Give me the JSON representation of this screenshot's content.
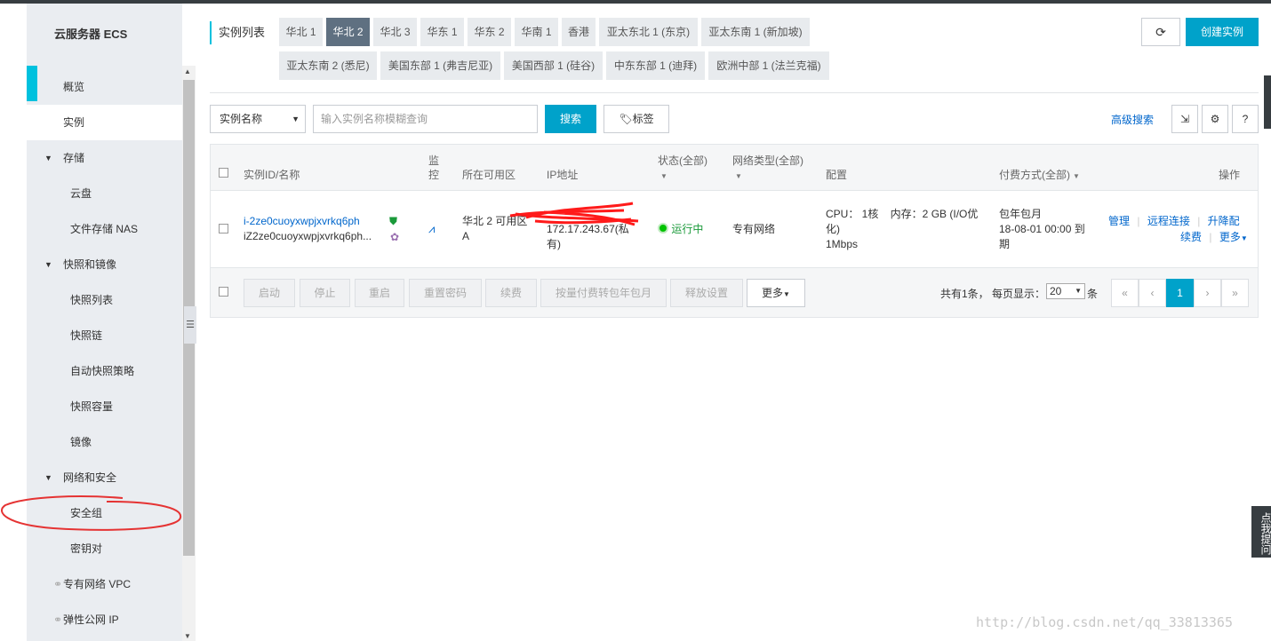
{
  "sidebar": {
    "title": "云服务器 ECS",
    "items": [
      {
        "label": "概览",
        "level": 1
      },
      {
        "label": "实例",
        "level": 1,
        "active": true
      },
      {
        "label": "存储",
        "level": 0
      },
      {
        "label": "云盘",
        "level": 2
      },
      {
        "label": "文件存储 NAS",
        "level": 2
      },
      {
        "label": "快照和镜像",
        "level": 0
      },
      {
        "label": "快照列表",
        "level": 2
      },
      {
        "label": "快照链",
        "level": 2
      },
      {
        "label": "自动快照策略",
        "level": 2
      },
      {
        "label": "快照容量",
        "level": 2
      },
      {
        "label": "镜像",
        "level": 2
      },
      {
        "label": "网络和安全",
        "level": 0
      },
      {
        "label": "安全组",
        "level": 2
      },
      {
        "label": "密钥对",
        "level": 2
      },
      {
        "label": "专有网络 VPC",
        "level": 1,
        "link": true
      },
      {
        "label": "弹性公网 IP",
        "level": 1,
        "link": true
      }
    ]
  },
  "header": {
    "title": "实例列表",
    "regions_row1": [
      "华北 1",
      "华北 2",
      "华北 3",
      "华东 1",
      "华东 2",
      "华南 1",
      "香港",
      "亚太东北 1 (东京)",
      "亚太东南 1 (新加坡)"
    ],
    "regions_row2": [
      "亚太东南 2 (悉尼)",
      "美国东部 1 (弗吉尼亚)",
      "美国西部 1 (硅谷)",
      "中东东部 1 (迪拜)",
      "欧洲中部 1 (法兰克福)"
    ],
    "active_region": "华北 2",
    "create_label": "创建实例"
  },
  "search": {
    "field_select": "实例名称",
    "placeholder": "输入实例名称模糊查询",
    "search_label": "搜索",
    "tag_label": "标签",
    "advanced_label": "高级搜索",
    "help_label": "?"
  },
  "table": {
    "columns": {
      "id": "实例ID/名称",
      "monitor": "监控",
      "zone": "所在可用区",
      "ip": "IP地址",
      "status": "状态(全部)",
      "network": "网络类型(全部)",
      "config": "配置",
      "billing": "付费方式(全部)",
      "actions": "操作"
    },
    "row": {
      "id": "i-2ze0cuoyxwpjxvrkq6ph",
      "name": "iZ2ze0cuoyxwpjxvrkq6ph...",
      "zone_line1": "华北 2 可用区",
      "zone_line2": "A",
      "ip_line1": "172.17.243.67(私",
      "ip_line2": "有)",
      "status": "运行中",
      "network": "专有网络",
      "config_line1": "CPU： 1核    内存：2 GB (I/O优",
      "config_line2": "化)",
      "config_line3": "1Mbps",
      "billing_line1": "包年包月",
      "billing_line2": "18-08-01 00:00 到",
      "billing_line3": "期",
      "action_manage": "管理",
      "action_remote": "远程连接",
      "action_upgrade": "升降配",
      "action_renew": "续费",
      "action_more": "更多"
    },
    "footer_buttons": [
      "启动",
      "停止",
      "重启",
      "重置密码",
      "续费",
      "按量付费转包年包月",
      "释放设置"
    ],
    "footer_more": "更多",
    "pagination": {
      "total_text": "共有1条，  每页显示：",
      "page_size": "20",
      "unit": "条",
      "current_page": "1"
    }
  },
  "float_help": "点我提问",
  "watermark": "http://blog.csdn.net/qq_33813365"
}
